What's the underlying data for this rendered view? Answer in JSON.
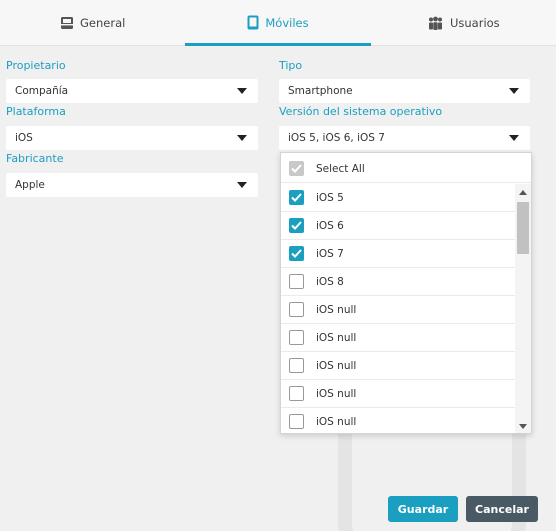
{
  "tabs": [
    {
      "label": "General",
      "icon": "inbox-tray-icon"
    },
    {
      "label": "Móviles",
      "icon": "tablet-icon",
      "active": true
    },
    {
      "label": "Usuarios",
      "icon": "users-icon"
    }
  ],
  "form": {
    "propietario": {
      "label": "Propietario",
      "value": "Compañía"
    },
    "plataforma": {
      "label": "Plataforma",
      "value": "iOS"
    },
    "fabricante": {
      "label": "Fabricante",
      "value": "Apple"
    },
    "tipo": {
      "label": "Tipo",
      "value": "Smartphone"
    },
    "version": {
      "label": "Versión del sistema operativo",
      "value": "iOS 5, iOS 6, iOS 7"
    }
  },
  "dropdown": {
    "select_all": "Select All",
    "options": [
      {
        "label": "iOS 5",
        "checked": true
      },
      {
        "label": "iOS 6",
        "checked": true
      },
      {
        "label": "iOS 7",
        "checked": true
      },
      {
        "label": "iOS 8",
        "checked": false
      },
      {
        "label": "iOS null",
        "checked": false
      },
      {
        "label": "iOS null",
        "checked": false
      },
      {
        "label": "iOS null",
        "checked": false
      },
      {
        "label": "iOS null",
        "checked": false
      },
      {
        "label": "iOS null",
        "checked": false
      }
    ]
  },
  "buttons": {
    "save": "Guardar",
    "cancel": "Cancelar"
  },
  "colors": {
    "accent": "#1a9fc0",
    "cancel": "#4a5a64"
  }
}
